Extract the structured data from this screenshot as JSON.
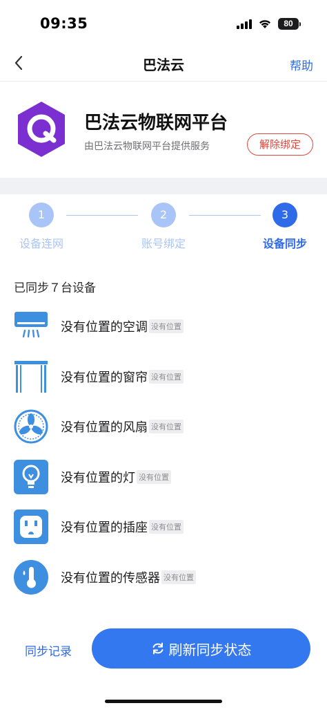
{
  "status_bar": {
    "time": "09:35",
    "battery": "80"
  },
  "nav": {
    "title": "巴法云",
    "help": "帮助"
  },
  "platform": {
    "name": "巴法云物联网平台",
    "subtitle": "由巴法云物联网平台提供服务",
    "unbind": "解除绑定"
  },
  "stepper": {
    "steps": [
      {
        "number": "1",
        "label": "设备连网",
        "state": "done"
      },
      {
        "number": "2",
        "label": "账号绑定",
        "state": "done"
      },
      {
        "number": "3",
        "label": "设备同步",
        "state": "active"
      }
    ]
  },
  "devices": {
    "synced_text": "已同步７台设备",
    "items": [
      {
        "name": "没有位置的空调",
        "tag": "没有位置",
        "icon": "air-conditioner-icon"
      },
      {
        "name": "没有位置的窗帘",
        "tag": "没有位置",
        "icon": "curtain-icon"
      },
      {
        "name": "没有位置的风扇",
        "tag": "没有位置",
        "icon": "fan-icon"
      },
      {
        "name": "没有位置的灯",
        "tag": "没有位置",
        "icon": "light-bulb-icon"
      },
      {
        "name": "没有位置的插座",
        "tag": "没有位置",
        "icon": "socket-icon"
      },
      {
        "name": "没有位置的传感器",
        "tag": "没有位置",
        "icon": "thermometer-icon"
      }
    ]
  },
  "footer": {
    "sync_log": "同步记录",
    "refresh": "刷新同步状态"
  },
  "colors": {
    "accent": "#2f6ae8",
    "button": "#3478f0",
    "danger": "#e0463c",
    "logo": "#7b2fd1",
    "icon_blue": "#3f8fe0"
  }
}
